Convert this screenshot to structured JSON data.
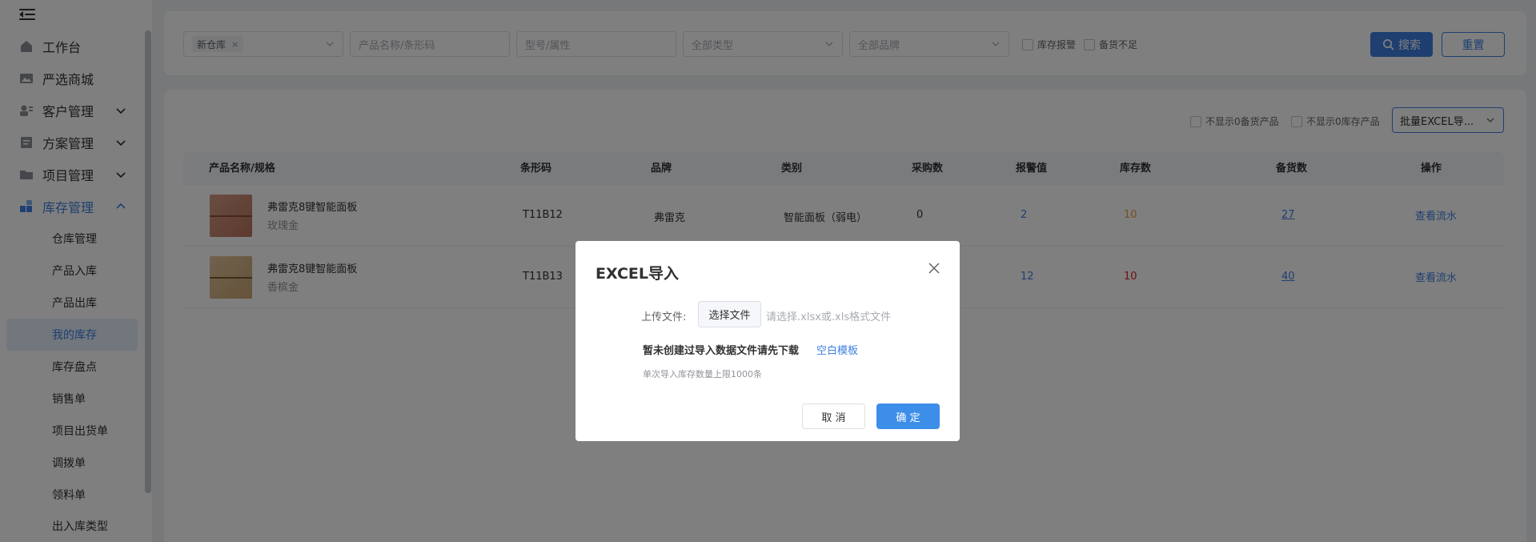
{
  "sidebar": {
    "toggle_icon": "menu-fold-icon",
    "items": [
      {
        "label": "工作台",
        "icon": "home-icon"
      },
      {
        "label": "严选商城",
        "icon": "image-icon"
      },
      {
        "label": "客户管理",
        "icon": "user-card-icon"
      },
      {
        "label": "方案管理",
        "icon": "document-icon"
      },
      {
        "label": "项目管理",
        "icon": "folder-icon"
      },
      {
        "label": "库存管理",
        "icon": "grid-icon"
      }
    ],
    "subitems": [
      "仓库管理",
      "产品入库",
      "产品出库",
      "我的库存",
      "库存盘点",
      "销售单",
      "项目出货单",
      "调拨单",
      "领料单",
      "出入库类型"
    ],
    "active_item": "库存管理",
    "selected_subitem": "我的库存"
  },
  "filters": {
    "warehouse_tag": "新仓库",
    "name_placeholder": "产品名称/条形码",
    "model_placeholder": "型号/属性",
    "type_placeholder": "全部类型",
    "brand_placeholder": "全部品牌",
    "check_stock_alarm": "库存报警",
    "check_insufficient": "备货不足",
    "search_label": "搜索",
    "reset_label": "重置"
  },
  "toolbar": {
    "hide_zero_prepared": "不显示0备货产品",
    "hide_zero_stock": "不显示0库存产品",
    "batch_select": "批量EXCEL导..."
  },
  "table": {
    "headers": [
      "产品名称/规格",
      "条形码",
      "品牌",
      "类别",
      "采购数",
      "报警值",
      "库存数",
      "备货数",
      "操作"
    ],
    "rows": [
      {
        "name": "弗雷克8键智能面板",
        "spec": "玫瑰金",
        "barcode": "T11B12",
        "brand": "弗雷克",
        "category": "智能面板（弱电）",
        "purchase": "0",
        "alarm": "2",
        "stock": "10",
        "prepared": "27",
        "action": "查看流水"
      },
      {
        "name": "弗雷克8键智能面板",
        "spec": "香槟金",
        "barcode": "T11B13",
        "brand": "",
        "category": "",
        "purchase": "",
        "alarm": "12",
        "stock": "10",
        "prepared": "40",
        "action": "查看流水"
      }
    ]
  },
  "modal": {
    "title": "EXCEL导入",
    "upload_label": "上传文件:",
    "choose_file": "选择文件",
    "file_hint": "请选择.xlsx或.xls格式文件",
    "template_text": "暂未创建过导入数据文件请先下载",
    "template_link": "空白模板",
    "limit_note": "单次导入库存数量上限1000条",
    "cancel": "取 消",
    "confirm": "确 定"
  },
  "colors": {
    "accent": "#3d7fe0",
    "stock_orange": "#e6a23c",
    "stock_red": "#e02020",
    "overlay": "rgba(0,0,0,0.5)"
  }
}
